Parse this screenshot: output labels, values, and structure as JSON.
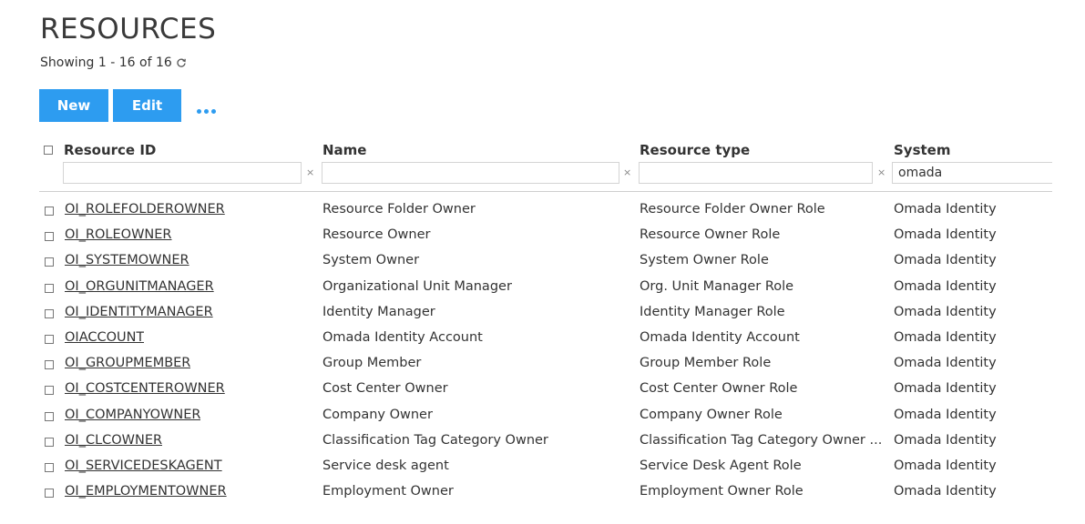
{
  "page": {
    "title": "RESOURCES",
    "count_text": "Showing 1 - 16 of 16"
  },
  "toolbar": {
    "new_label": "New",
    "edit_label": "Edit"
  },
  "columns": {
    "resource_id": "Resource ID",
    "name": "Name",
    "resource_type": "Resource type",
    "system": "System"
  },
  "filters": {
    "resource_id": "",
    "name": "",
    "resource_type": "",
    "system": "omada",
    "clear_symbol": "×"
  },
  "rows": [
    {
      "id": "OI_ROLEFOLDEROWNER",
      "name": "Resource Folder Owner",
      "type": "Resource Folder Owner Role",
      "system": "Omada Identity"
    },
    {
      "id": "OI_ROLEOWNER",
      "name": "Resource Owner",
      "type": "Resource Owner Role",
      "system": "Omada Identity"
    },
    {
      "id": "OI_SYSTEMOWNER",
      "name": "System Owner",
      "type": "System Owner Role",
      "system": "Omada Identity"
    },
    {
      "id": "OI_ORGUNITMANAGER",
      "name": "Organizational Unit Manager",
      "type": "Org. Unit Manager Role",
      "system": "Omada Identity"
    },
    {
      "id": "OI_IDENTITYMANAGER",
      "name": "Identity Manager",
      "type": "Identity Manager Role",
      "system": "Omada Identity"
    },
    {
      "id": "OIACCOUNT",
      "name": "Omada Identity Account",
      "type": "Omada Identity Account",
      "system": "Omada Identity"
    },
    {
      "id": "OI_GROUPMEMBER",
      "name": "Group Member",
      "type": "Group Member Role",
      "system": "Omada Identity"
    },
    {
      "id": "OI_COSTCENTEROWNER",
      "name": "Cost Center Owner",
      "type": "Cost Center Owner Role",
      "system": "Omada Identity"
    },
    {
      "id": "OI_COMPANYOWNER",
      "name": "Company Owner",
      "type": "Company Owner Role",
      "system": "Omada Identity"
    },
    {
      "id": "OI_CLCOWNER",
      "name": "Classification Tag Category Owner",
      "type": "Classification Tag Category Owner ...",
      "system": "Omada Identity"
    },
    {
      "id": "OI_SERVICEDESKAGENT",
      "name": "Service desk agent",
      "type": "Service Desk Agent Role",
      "system": "Omada Identity"
    },
    {
      "id": "OI_EMPLOYMENTOWNER",
      "name": "Employment Owner",
      "type": "Employment Owner Role",
      "system": "Omada Identity"
    }
  ],
  "colors": {
    "accent": "#2d9cf0"
  }
}
